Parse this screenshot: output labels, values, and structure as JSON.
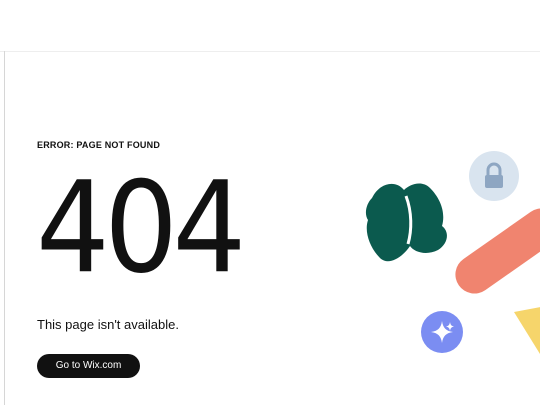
{
  "error": {
    "label": "ERROR: PAGE NOT FOUND",
    "code": "404",
    "message": "This page isn't available."
  },
  "cta": {
    "label": "Go to Wix.com"
  },
  "illustration": {
    "colors": {
      "green_shape": "#0b5a4e",
      "lock_circle": "#d9e4ef",
      "lock_icon": "#8ea6c2",
      "coral_bar": "#f0846f",
      "sparkle_circle": "#7b8df2",
      "yellow_triangle": "#f6d56b"
    },
    "icons": [
      "lock-icon",
      "sparkle-icon"
    ]
  }
}
